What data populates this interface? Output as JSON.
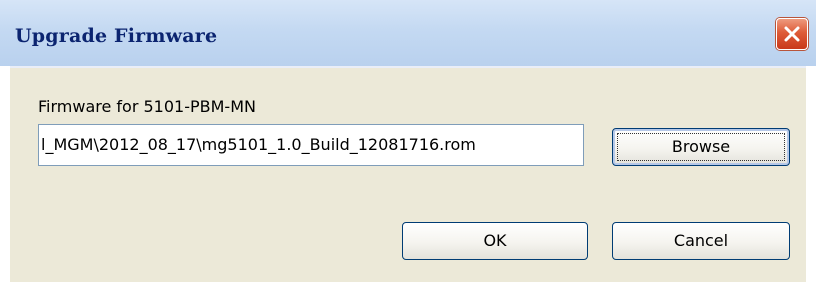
{
  "dialog": {
    "title": "Upgrade Firmware",
    "close_icon": "close-icon"
  },
  "form": {
    "label": "Firmware for 5101-PBM-MN",
    "path_value": "l_MGM\\2012_08_17\\mg5101_1.0_Build_12081716.rom"
  },
  "buttons": {
    "browse": "Browse",
    "ok": "OK",
    "cancel": "Cancel"
  },
  "colors": {
    "title_text": "#0b2470",
    "titlebar": "#c4d9f2",
    "dialog_background": "#ece9d8",
    "close_button": "#de5b38",
    "button_border": "#003c74"
  }
}
